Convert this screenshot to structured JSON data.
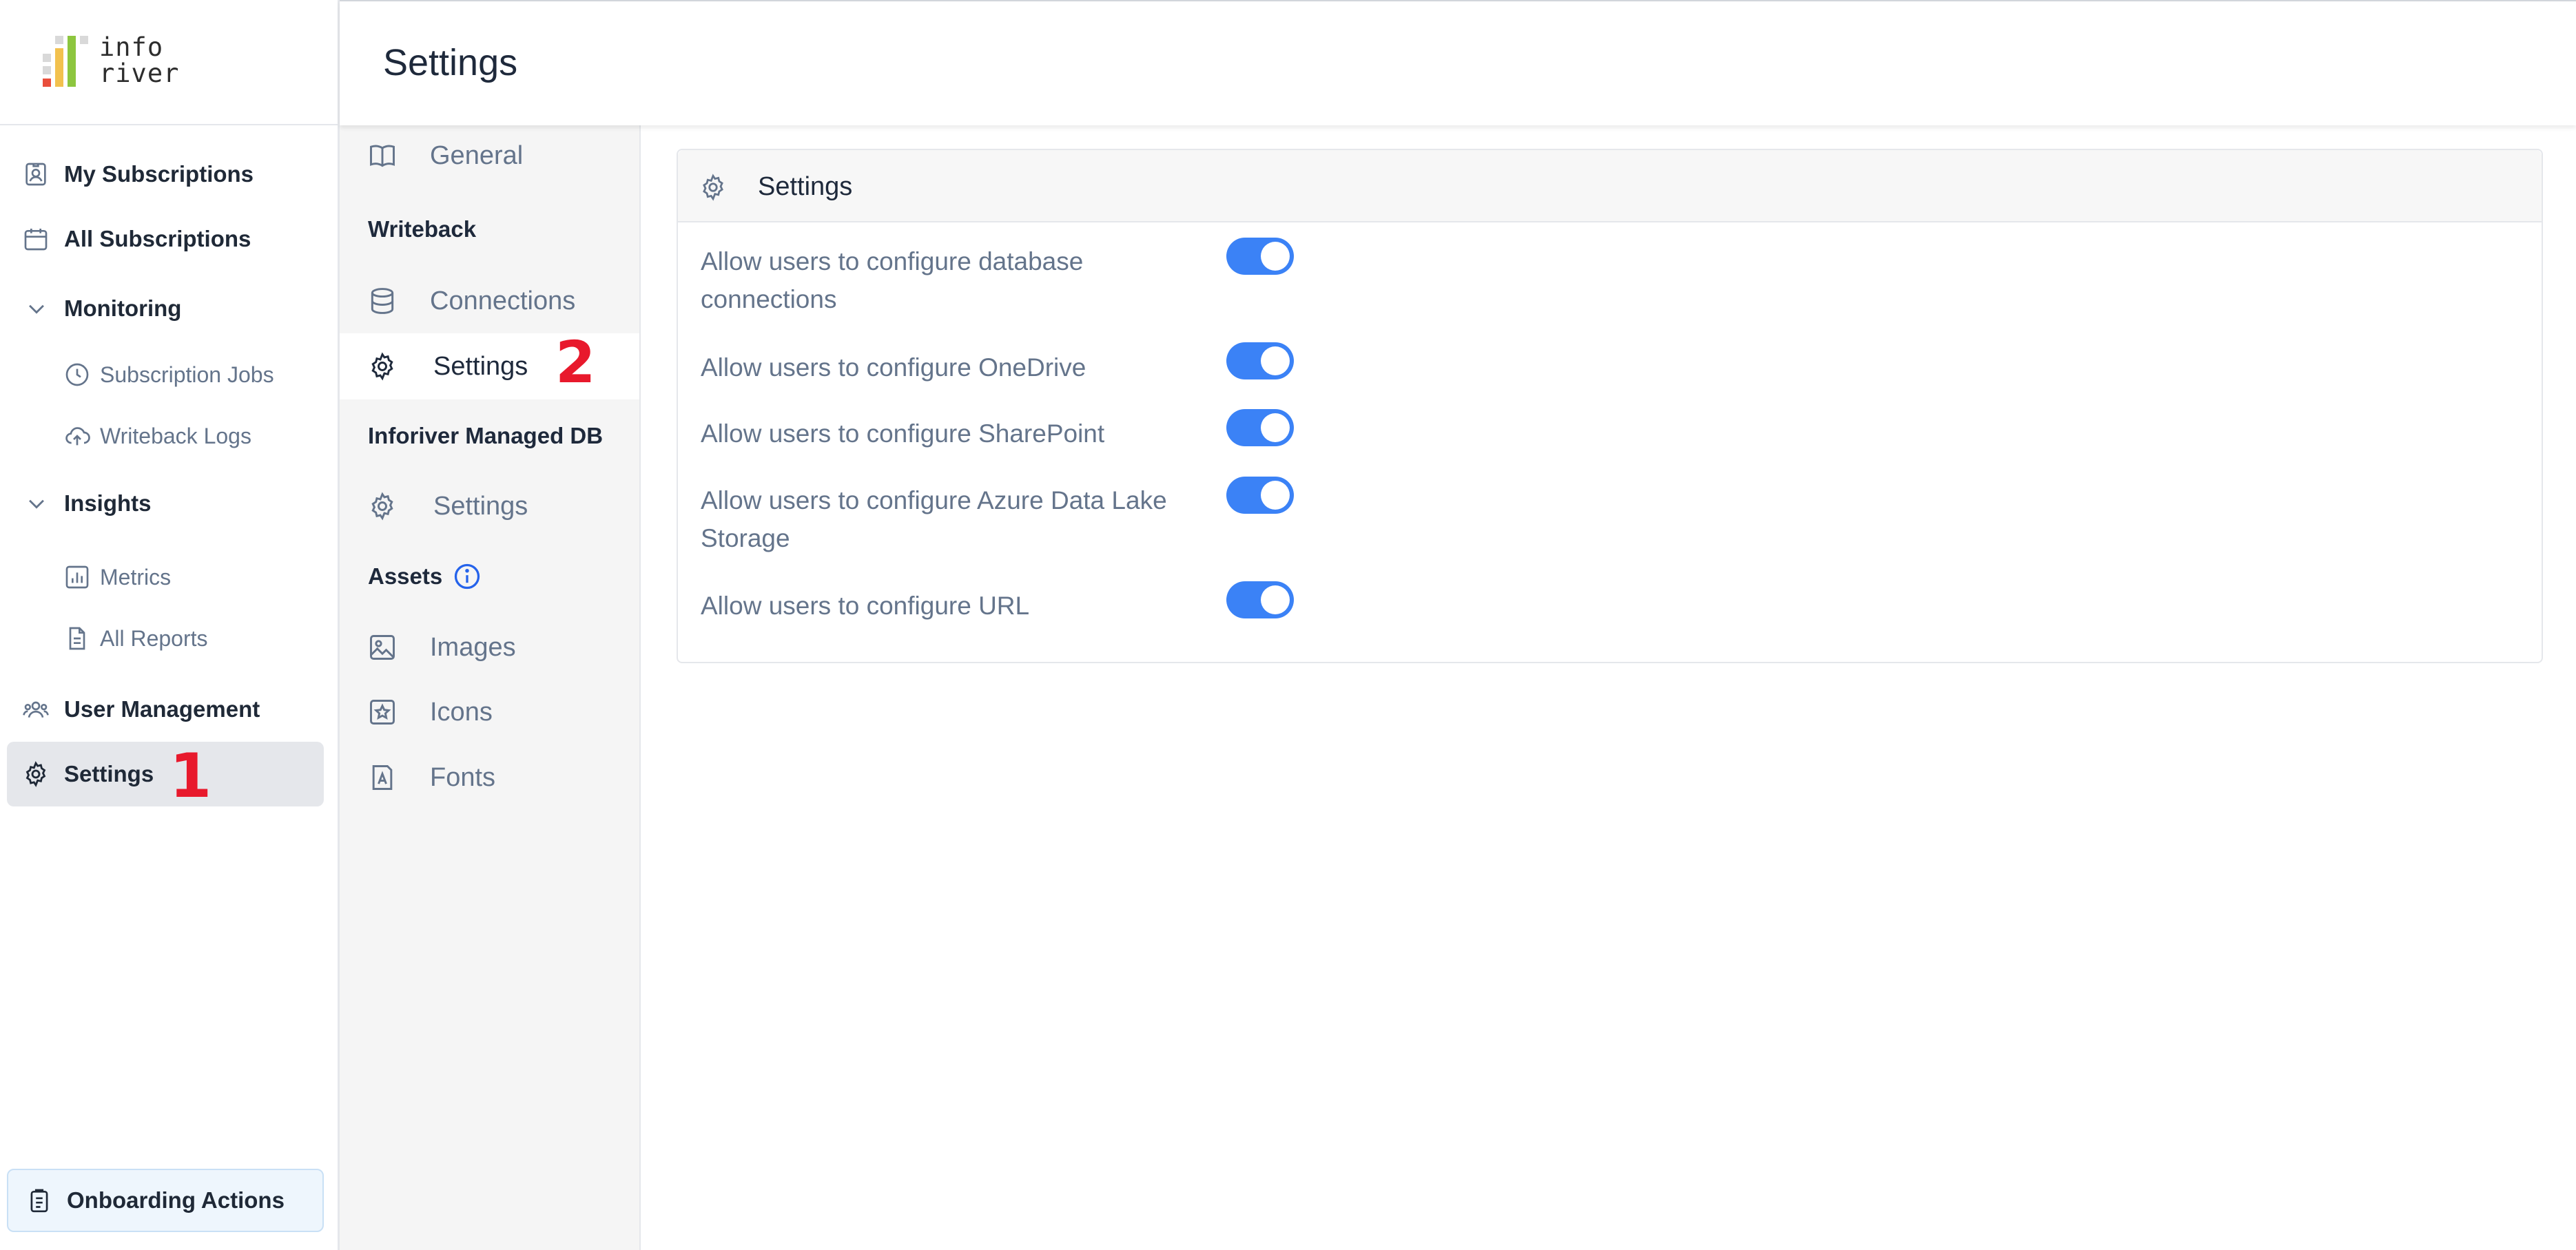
{
  "header": {
    "title": "Settings"
  },
  "brand": {
    "logo_lines": [
      "info",
      "river"
    ],
    "bar_colors": [
      "#d9d9d9",
      "#f2c14e",
      "#8dc63f",
      "#e94e3c"
    ]
  },
  "sidebar": {
    "items": [
      {
        "label": "My Subscriptions",
        "icon": "user-card-icon"
      },
      {
        "label": "All Subscriptions",
        "icon": "calendar-icon"
      },
      {
        "label": "Monitoring",
        "icon": "chevron-down-icon"
      },
      {
        "label": "Subscription Jobs",
        "icon": "clock-icon"
      },
      {
        "label": "Writeback Logs",
        "icon": "cloud-upload-icon"
      },
      {
        "label": "Insights",
        "icon": "chevron-down-icon"
      },
      {
        "label": "Metrics",
        "icon": "bar-chart-icon"
      },
      {
        "label": "All Reports",
        "icon": "document-icon"
      },
      {
        "label": "User Management",
        "icon": "users-icon"
      },
      {
        "label": "Settings",
        "icon": "gear-icon",
        "active": true
      }
    ],
    "onboarding": {
      "label": "Onboarding Actions",
      "icon": "clipboard-icon"
    }
  },
  "annotations": {
    "marker_1": "1",
    "marker_2": "2"
  },
  "submenu": {
    "general": "General",
    "writeback_heading": "Writeback",
    "connections": "Connections",
    "writeback_settings": "Settings",
    "managed_db_heading": "Inforiver Managed DB",
    "managed_db_settings": "Settings",
    "assets_heading": "Assets",
    "images": "Images",
    "icons": "Icons",
    "fonts": "Fonts"
  },
  "panel": {
    "title": "Settings",
    "options": [
      {
        "label": "Allow users to configure database connections",
        "enabled": true
      },
      {
        "label": "Allow users to configure OneDrive",
        "enabled": true
      },
      {
        "label": "Allow users to configure SharePoint",
        "enabled": true
      },
      {
        "label": "Allow users to configure Azure Data Lake Storage",
        "enabled": true
      },
      {
        "label": "Allow users to configure URL",
        "enabled": true
      }
    ]
  },
  "colors": {
    "accent": "#3b82f6",
    "marker": "#e8192c",
    "active_bg": "#e5e7eb"
  }
}
